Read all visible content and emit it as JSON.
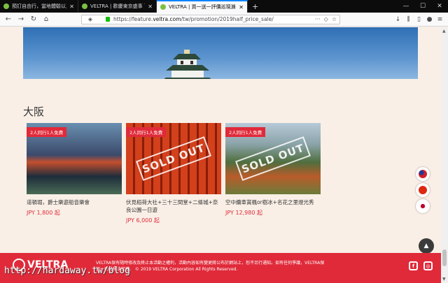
{
  "browser": {
    "tabs": [
      {
        "title": "預訂自由行，當地體驗以及超值"
      },
      {
        "title": "VELTRA | 歡慶東京盛事 百萬家"
      },
      {
        "title": "VELTRA | 買一送一評價巡現瀨"
      }
    ],
    "url_prefix": "https://feature.",
    "url_domain": "veltra.com",
    "url_path": "/tw/promotion/2019half_price_sale/"
  },
  "section": {
    "title": "大阪"
  },
  "cards": [
    {
      "badge": "2人同行1人免費",
      "name": "道頓堀，爵士樂遊船音樂會",
      "price": "JPY 1,800 起",
      "sold_out": false
    },
    {
      "badge": "2人同行1人免費",
      "name": "伏見稻荷大社+三十三間堂+二條城+奈良公園一日遊",
      "price": "JPY 6,000 起",
      "sold_out": true
    },
    {
      "badge": "2人同行1人免費",
      "name": "空中纜車賞楓or樹冰+名花之里燈光秀",
      "price": "JPY 12,980 起",
      "sold_out": true
    }
  ],
  "sold_out_label": "SOLD OUT",
  "footer": {
    "logo": "VELTRA",
    "text": "VELTRA保有隨時修改及終止本活動之權利，活動內容如有變更將公布於網站上，恕不另行通知。如有任何爭議，VELTRA保留一切最終決定權。 © 2019 VELTRA Corporation All Rights Reserved."
  },
  "watermark": "http://hardaway.tw/blog",
  "colors": {
    "accent": "#e02a3a",
    "background": "#f9efe6"
  }
}
